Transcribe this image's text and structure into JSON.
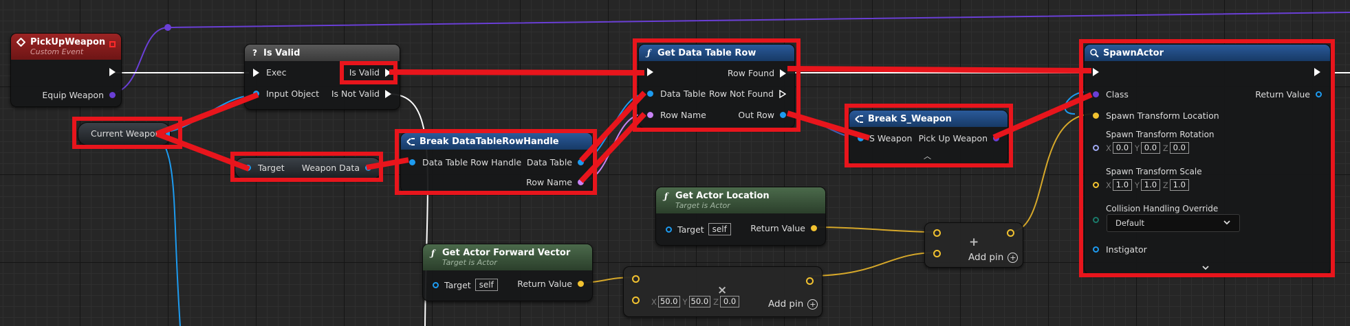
{
  "colors": {
    "highlight": "#e8151c",
    "event_header": "#8c1a1a",
    "function_header": "#1f4a7a",
    "pure_header": "#3c5a3c",
    "object_pin": "#1d9bf0",
    "struct_pin": "#9a4ff5",
    "vector_pin": "#f2c230",
    "exec_pin": "#ffffff",
    "name_pin": "#c883f5",
    "transform_pin": "#f08c28"
  },
  "nodes": {
    "pickup_weapon": {
      "title": "PickUpWeapon",
      "subtitle": "Custom Event",
      "pin_out": "Equip Weapon"
    },
    "is_valid": {
      "title": "Is Valid",
      "pin_exec": "Exec",
      "pin_input": "Input Object",
      "pin_valid": "Is Valid",
      "pin_not_valid": "Is Not Valid"
    },
    "current_weapon": {
      "label": "Current Weapon"
    },
    "weapon_data": {
      "target": "Target",
      "out": "Weapon Data"
    },
    "break_dt_row_handle": {
      "title": "Break DataTableRowHandle",
      "pin_in": "Data Table Row Handle",
      "pin_data_table": "Data Table",
      "pin_row_name": "Row Name"
    },
    "get_data_table_row": {
      "title": "Get Data Table Row",
      "pin_data_table": "Data Table",
      "pin_row_name": "Row Name",
      "pin_row_found": "Row Found",
      "pin_row_not_found": "Row Not Found",
      "pin_out_row": "Out Row"
    },
    "break_s_weapon": {
      "title": "Break S_Weapon",
      "pin_in": "S Weapon",
      "pin_out": "Pick Up Weapon"
    },
    "get_actor_location": {
      "title": "Get Actor Location",
      "subtitle": "Target is Actor",
      "target": "Target",
      "self": "self",
      "return": "Return Value"
    },
    "get_actor_forward_vector": {
      "title": "Get Actor Forward Vector",
      "subtitle": "Target is Actor",
      "target": "Target",
      "self": "self",
      "return": "Return Value"
    },
    "multiply_vector": {
      "x_label": "X",
      "x": "50.0",
      "y_label": "Y",
      "y": "50.0",
      "z_label": "Z",
      "z": "0.0",
      "add_pin": "Add pin"
    },
    "add_vector": {
      "add_pin": "Add pin"
    },
    "spawn_actor": {
      "title": "SpawnActor",
      "class": "Class",
      "return": "Return Value",
      "spawn_location": "Spawn Transform Location",
      "spawn_rotation": "Spawn Transform Rotation",
      "rot_x_label": "X",
      "rot_x": "0.0",
      "rot_y_label": "Y",
      "rot_y": "0.0",
      "rot_z_label": "Z",
      "rot_z": "0.0",
      "spawn_scale": "Spawn Transform Scale",
      "scale_x_label": "X",
      "scale_x": "1.0",
      "scale_y_label": "Y",
      "scale_y": "1.0",
      "scale_z_label": "Z",
      "scale_z": "1.0",
      "collision": "Collision Handling Override",
      "collision_value": "Default",
      "instigator": "Instigator"
    }
  }
}
